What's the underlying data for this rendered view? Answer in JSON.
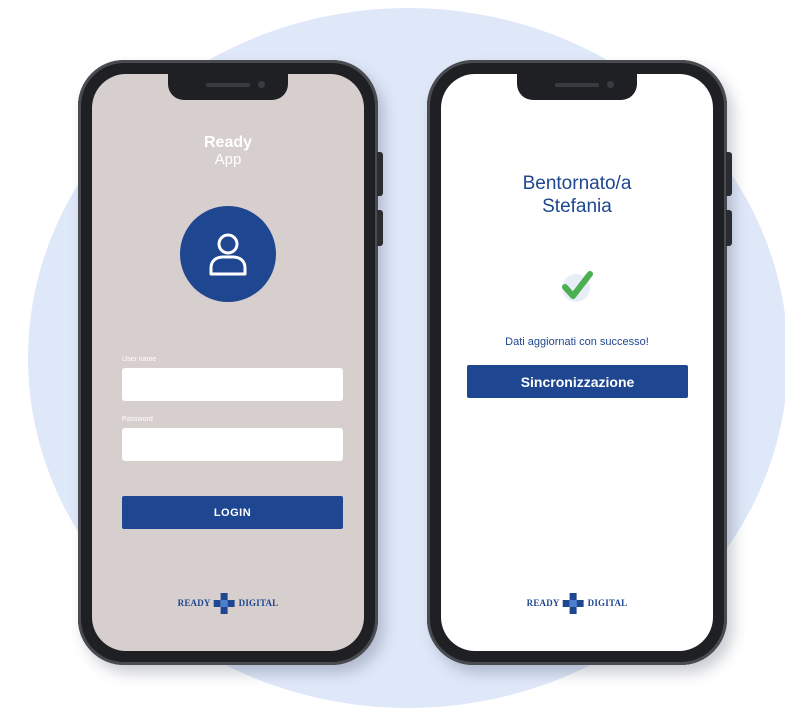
{
  "login_screen": {
    "app_title": "Ready",
    "app_subtitle": "App",
    "username_label": "User name",
    "password_label": "Password",
    "login_button": "LOGIN",
    "logo_left": "READY",
    "logo_right": "DIGITAL"
  },
  "success_screen": {
    "welcome_line1": "Bentornato/a",
    "welcome_line2": "Stefania",
    "status_message": "Dati aggiornati con successo!",
    "sync_button": "Sincronizzazione",
    "logo_left": "READY",
    "logo_right": "DIGITAL"
  },
  "colors": {
    "brand_blue": "#1f4690",
    "login_bg": "#d7cfcd",
    "check_green": "#4caf50",
    "backdrop_circle": "#dfe8f8"
  },
  "icons": [
    "user-icon",
    "check-icon",
    "ready-digital-logo"
  ]
}
